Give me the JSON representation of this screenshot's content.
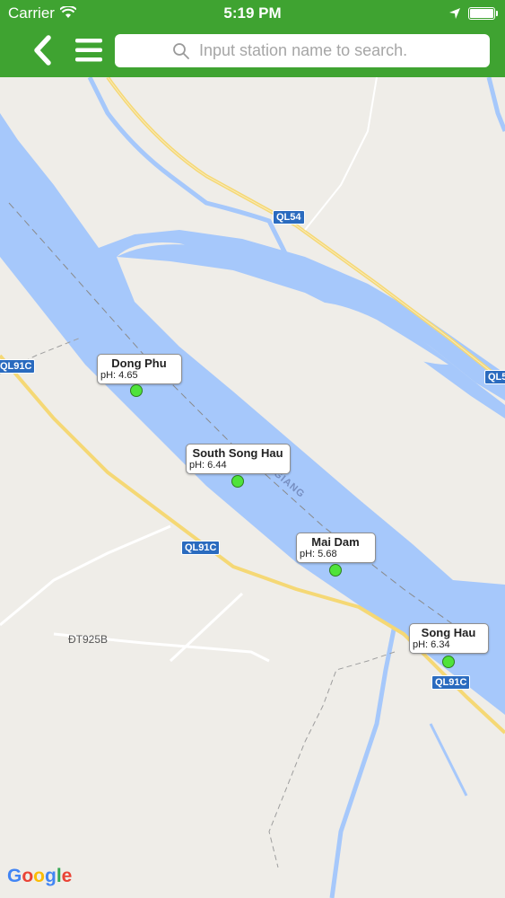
{
  "status": {
    "carrier": "Carrier",
    "time": "5:19 PM"
  },
  "nav": {
    "search_placeholder": "Input station name to search."
  },
  "map": {
    "road_labels": [
      "QL54",
      "QL91C",
      "QL91C",
      "QL91C",
      "QL5"
    ],
    "place_labels": [
      "ĐT925B"
    ],
    "river_label": "NG GIANG"
  },
  "stations": [
    {
      "name": "Dong Phu",
      "ph": "pH: 4.65"
    },
    {
      "name": "South Song Hau",
      "ph": "pH: 6.44"
    },
    {
      "name": "Mai Dam",
      "ph": "pH: 5.68"
    },
    {
      "name": "Song Hau",
      "ph": "pH: 6.34"
    }
  ],
  "attribution": "Google",
  "colors": {
    "nav_green": "#3fa331",
    "water": "#a6c8fb",
    "land": "#efede8",
    "marker": "#4fe33a"
  }
}
